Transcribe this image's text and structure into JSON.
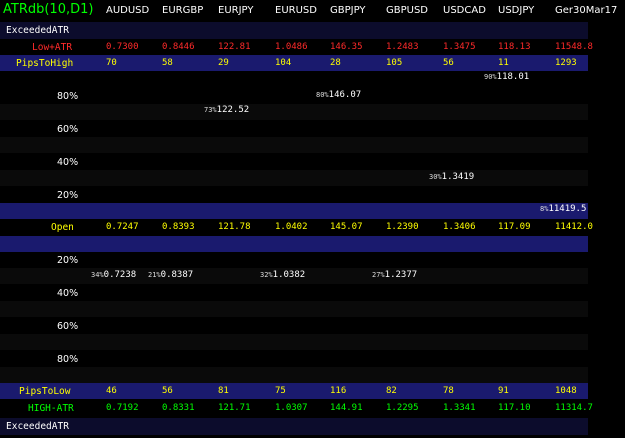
{
  "title": "ATRdb(10,D1)",
  "columns": [
    "AUDUSD",
    "EURGBP",
    "EURJPY",
    "EURUSD",
    "GBPJPY",
    "GBPUSD",
    "USDCAD",
    "USDJPY",
    "Ger30Mar17"
  ],
  "rows": {
    "exceeded_top": "ExceededATR",
    "low_atr": {
      "label": "Low+ATR",
      "values": [
        "0.7300",
        "0.8446",
        "122.81",
        "1.0486",
        "146.35",
        "1.2483",
        "1.3475",
        "118.13",
        "11548.8"
      ]
    },
    "pips_to_high": {
      "label": "PipsToHigh",
      "values": [
        "70",
        "58",
        "29",
        "104",
        "28",
        "105",
        "56",
        "11",
        "1293"
      ]
    },
    "open": {
      "label": "Open",
      "values": [
        "0.7247",
        "0.8393",
        "121.78",
        "1.0402",
        "145.07",
        "1.2390",
        "1.3406",
        "117.09",
        "11412.0"
      ]
    },
    "pips_to_low": {
      "label": "PipsToLow",
      "values": [
        "46",
        "56",
        "81",
        "75",
        "116",
        "82",
        "78",
        "91",
        "1048"
      ]
    },
    "high_atr": {
      "label": "HIGH-ATR",
      "values": [
        "0.7192",
        "0.8331",
        "121.71",
        "1.0307",
        "144.91",
        "1.2295",
        "1.3341",
        "117.10",
        "11314.7"
      ]
    },
    "exceeded_bottom": "ExceededATR"
  },
  "upper_pcts": [
    "80%",
    "60%",
    "40%",
    "20%"
  ],
  "lower_pcts": [
    "20%",
    "40%",
    "60%",
    "80%"
  ],
  "upper_marks": [
    {
      "pct": "90%",
      "price": "118.01"
    },
    {
      "pct": "80%",
      "price": "146.07"
    },
    {
      "pct": "73%",
      "price": "122.52"
    },
    {
      "pct": "30%",
      "price": "1.3419"
    },
    {
      "pct": "8%",
      "price": "11419.5"
    }
  ],
  "lower_marks": [
    {
      "pct": "34%",
      "price": "0.7238"
    },
    {
      "pct": "21%",
      "price": "0.8387"
    },
    {
      "pct": "32%",
      "price": "1.0382"
    },
    {
      "pct": "27%",
      "price": "1.2377"
    }
  ],
  "colors": {
    "title": "#00ff00",
    "low_atr": "#ff2a2a",
    "high_atr": "#00ff00",
    "label": "#ffff00",
    "header_band": "#1a1a6e"
  }
}
